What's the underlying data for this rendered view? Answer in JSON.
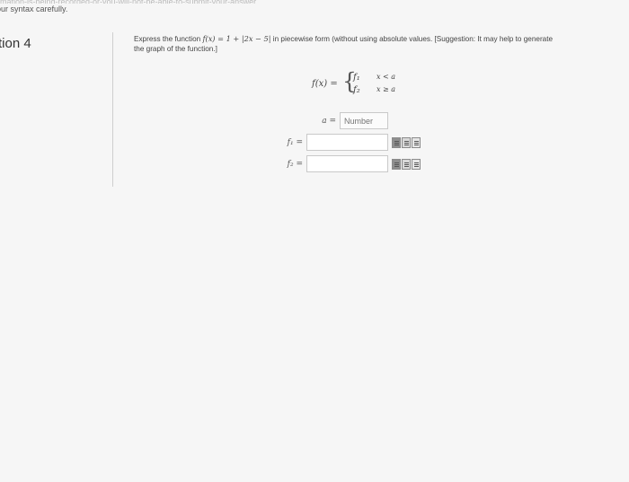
{
  "page": {
    "top_text": "mation-is-being-recorded-or-you-will-not-be-able-to-submit-your-answer",
    "syntax_note": "our syntax carefully.",
    "question_label": "tion 4"
  },
  "question": {
    "prompt_before": "Express the function",
    "function": "f(x) = 1 + |2x − 5|",
    "prompt_after": "in piecewise form (without using absolute values. [Suggestion: It may help to generate the graph of the function.]"
  },
  "piecewise": {
    "lhs": "f(x) =",
    "brace": "{",
    "case1": "f₁",
    "cond1": "x < a",
    "case2": "f₂",
    "cond2": "x ≥ a"
  },
  "fields": {
    "a_label": "a =",
    "a_placeholder": "Number",
    "f1_label": "f₁ =",
    "f2_label": "f₂ ="
  },
  "icons": [
    "formula-editor-icon",
    "calculator-icon",
    "preview-icon"
  ]
}
